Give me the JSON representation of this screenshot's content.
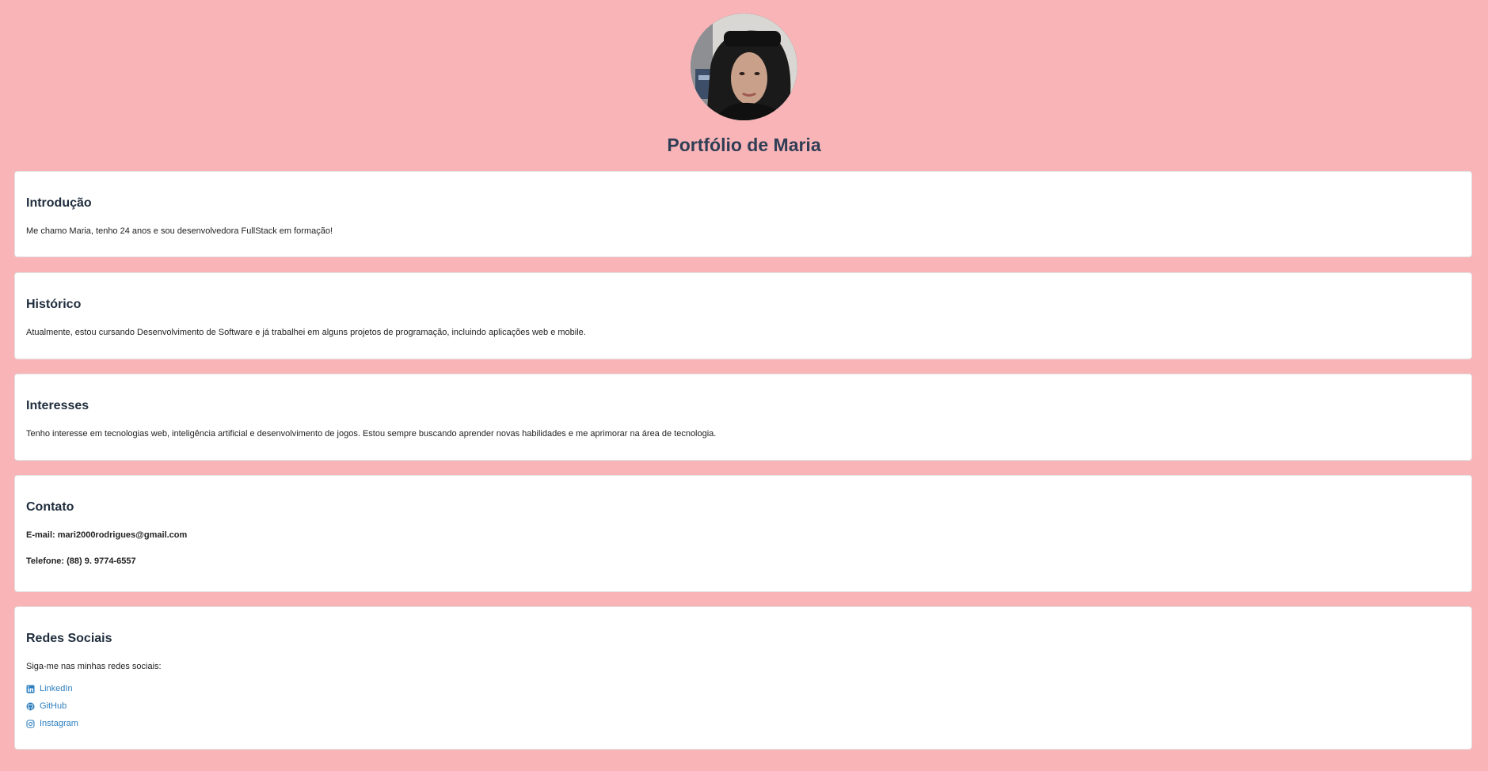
{
  "header": {
    "title": "Portfólio de Maria"
  },
  "sections": {
    "intro": {
      "heading": "Introdução",
      "text": "Me chamo Maria, tenho 24 anos e sou desenvolvedora FullStack em formação!"
    },
    "history": {
      "heading": "Histórico",
      "text": "Atualmente, estou cursando Desenvolvimento de Software e já trabalhei em alguns projetos de programação, incluindo aplicações web e mobile."
    },
    "interests": {
      "heading": "Interesses",
      "text": "Tenho interesse em tecnologias web, inteligência artificial e desenvolvimento de jogos. Estou sempre buscando aprender novas habilidades e me aprimorar na área de tecnologia."
    },
    "contact": {
      "heading": "Contato",
      "email": "E-mail: mari2000rodrigues@gmail.com",
      "phone": "Telefone: (88) 9. 9774-6557"
    },
    "social": {
      "heading": "Redes Sociais",
      "text": "Siga-me nas minhas redes sociais:",
      "links": [
        {
          "label": "LinkedIn",
          "icon": "linkedin-icon"
        },
        {
          "label": "GitHub",
          "icon": "github-icon"
        },
        {
          "label": "Instagram",
          "icon": "instagram-icon"
        }
      ]
    }
  },
  "colors": {
    "background": "#f9b4b7",
    "card": "#ffffff",
    "heading": "#1f2d3d",
    "link": "#2e7fbf"
  }
}
